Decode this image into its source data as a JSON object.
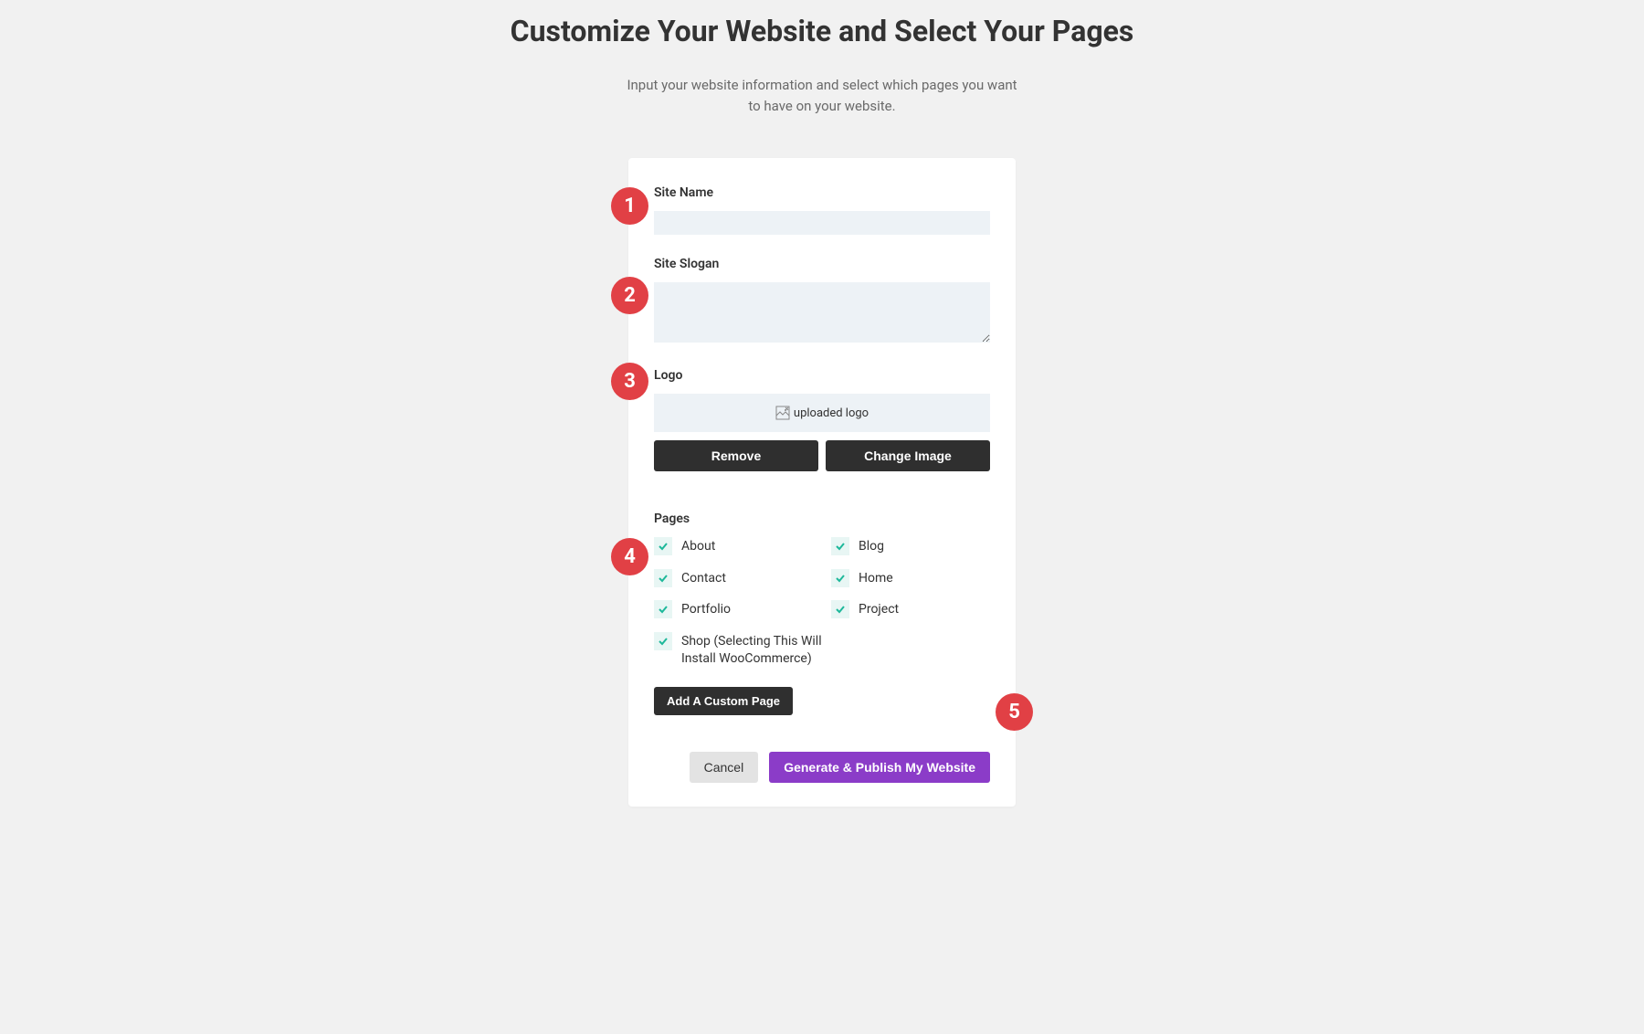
{
  "header": {
    "title": "Customize Your Website and Select Your Pages",
    "subtitle": "Input your website information and select which pages you want to have on your website."
  },
  "form": {
    "site_name": {
      "label": "Site Name",
      "value": ""
    },
    "site_slogan": {
      "label": "Site Slogan",
      "value": ""
    },
    "logo": {
      "label": "Logo",
      "alt_text": "uploaded logo",
      "remove_label": "Remove",
      "change_label": "Change Image"
    },
    "pages": {
      "label": "Pages",
      "items": [
        {
          "label": "About",
          "checked": true
        },
        {
          "label": "Blog",
          "checked": true
        },
        {
          "label": "Contact",
          "checked": true
        },
        {
          "label": "Home",
          "checked": true
        },
        {
          "label": "Portfolio",
          "checked": true
        },
        {
          "label": "Project",
          "checked": true
        },
        {
          "label": "Shop (Selecting This Will Install WooCommerce)",
          "checked": true
        }
      ],
      "add_custom_label": "Add A Custom Page"
    },
    "actions": {
      "cancel_label": "Cancel",
      "submit_label": "Generate & Publish My Website"
    }
  },
  "annotations": [
    "1",
    "2",
    "3",
    "4",
    "5"
  ]
}
